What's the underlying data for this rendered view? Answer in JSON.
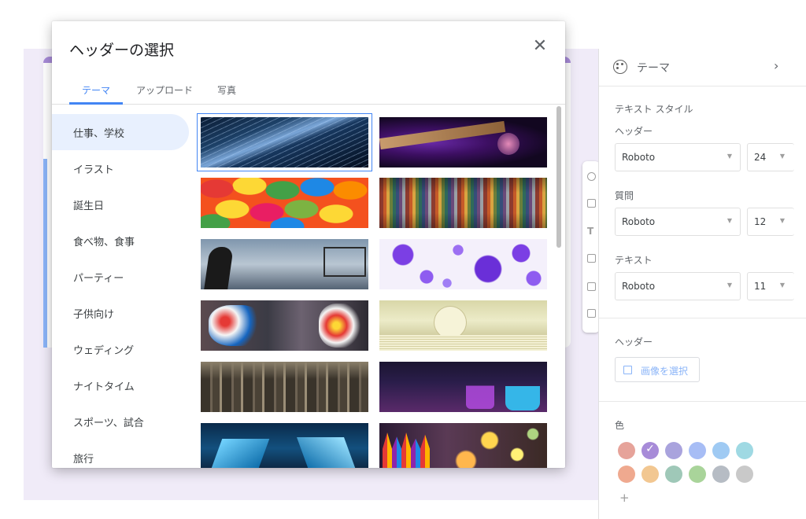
{
  "dialog": {
    "title": "ヘッダーの選択",
    "close_icon": "close-icon",
    "tabs": [
      {
        "label": "テーマ",
        "active": true
      },
      {
        "label": "アップロード",
        "active": false
      },
      {
        "label": "写真",
        "active": false
      }
    ],
    "categories": [
      {
        "label": "仕事、学校",
        "active": true
      },
      {
        "label": "イラスト",
        "active": false
      },
      {
        "label": "誕生日",
        "active": false
      },
      {
        "label": "食べ物、食事",
        "active": false
      },
      {
        "label": "パーティー",
        "active": false
      },
      {
        "label": "子供向け",
        "active": false
      },
      {
        "label": "ウェディング",
        "active": false
      },
      {
        "label": "ナイトタイム",
        "active": false
      },
      {
        "label": "スポーツ、試合",
        "active": false
      },
      {
        "label": "旅行",
        "active": false
      }
    ],
    "thumbnails_selected_index": 0,
    "thumbnail_count": 12
  },
  "right_panel": {
    "header": {
      "title": "テーマ",
      "icon": "palette-icon"
    },
    "text_style_label": "テキスト スタイル",
    "header_style": {
      "label": "ヘッダー",
      "font": "Roboto",
      "size": "24"
    },
    "question_style": {
      "label": "質問",
      "font": "Roboto",
      "size": "12"
    },
    "text_style": {
      "label": "テキスト",
      "font": "Roboto",
      "size": "11"
    },
    "header_image_label": "ヘッダー",
    "select_image_button": "画像を選択",
    "color_label": "色",
    "add_color": "+",
    "colors": [
      "#e6a39a",
      "#a78bd8",
      "#a9a3dd",
      "#a7bdf5",
      "#9fcaf3",
      "#9fd9e3",
      "#efa98f",
      "#f2c791",
      "#9fc8b8",
      "#a9d49a",
      "#b6bcc4",
      "#c9c9c9"
    ],
    "selected_color_index": 1
  }
}
